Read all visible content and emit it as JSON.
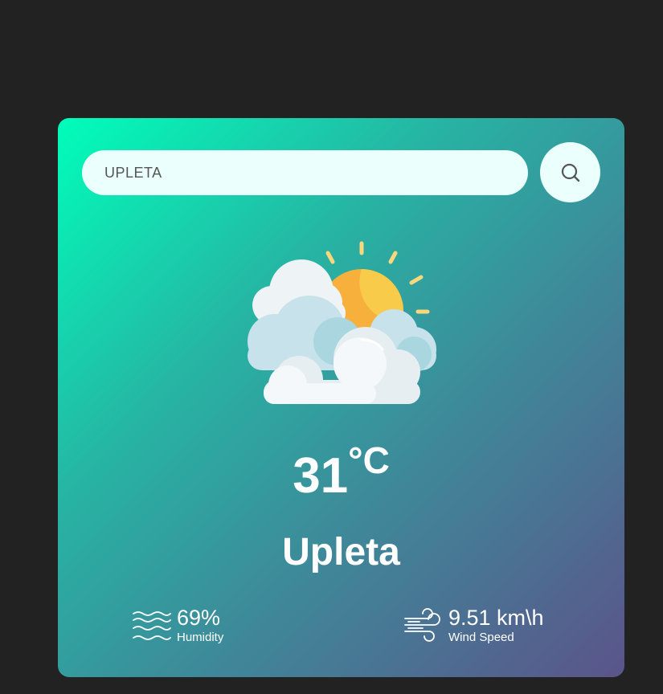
{
  "search": {
    "value": "UPLETA",
    "icon": "search-icon"
  },
  "weather": {
    "icon": "sun-behind-clouds-icon",
    "temperature": "31",
    "temperature_unit": "°C",
    "city": "Upleta"
  },
  "details": {
    "humidity": {
      "icon": "humidity-waves-icon",
      "value": "69%",
      "label": "Humidity"
    },
    "wind": {
      "icon": "wind-icon",
      "value": "9.51 km\\h",
      "label": "Wind Speed"
    }
  },
  "colors": {
    "page_background": "#222222",
    "card_gradient_start": "#00feba",
    "card_gradient_end": "#5b548a",
    "input_background": "#ebfffc",
    "sun": "#f8b63c",
    "cloud": "#eef3f6"
  }
}
